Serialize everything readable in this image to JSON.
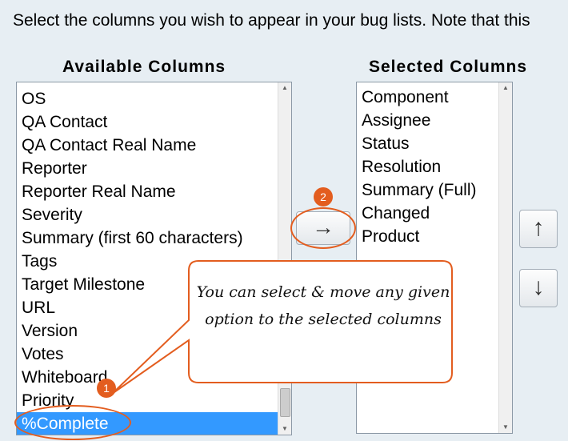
{
  "intro_text": "Select the columns you wish to appear in your bug lists. Note that this",
  "available": {
    "heading": "Available Columns",
    "items": [
      "OS",
      "QA Contact",
      "QA Contact Real Name",
      "Reporter",
      "Reporter Real Name",
      "Severity",
      "Summary (first 60 characters)",
      "Tags",
      "Target Milestone",
      "URL",
      "Version",
      "Votes",
      "Whiteboard",
      "Priority",
      "%Complete"
    ],
    "selected_item": "%Complete"
  },
  "selected": {
    "heading": "Selected Columns",
    "items": [
      "Component",
      "Assignee",
      "Status",
      "Resolution",
      "Summary (Full)",
      "Changed",
      "Product"
    ]
  },
  "buttons": {
    "add_arrow": "→",
    "move_up": "↑",
    "move_down": "↓"
  },
  "callouts": {
    "badge_1": "1",
    "badge_2": "2",
    "tooltip": "You can select & move any given option to the selected columns"
  },
  "colors": {
    "accent": "#e35d1f",
    "selection": "#3399ff",
    "background": "#e7eef3"
  }
}
